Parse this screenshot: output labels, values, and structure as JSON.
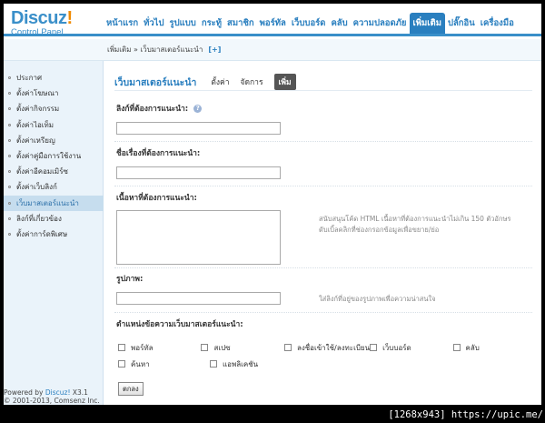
{
  "logo": {
    "main": "Discuz",
    "bang": "!",
    "sub": "Control Panel"
  },
  "nav": {
    "items": [
      {
        "label": "หน้าแรก",
        "active": false
      },
      {
        "label": "ทั่วไป",
        "active": false
      },
      {
        "label": "รูปแบบ",
        "active": false
      },
      {
        "label": "กระทู้",
        "active": false
      },
      {
        "label": "สมาชิก",
        "active": false
      },
      {
        "label": "พอร์ทัล",
        "active": false
      },
      {
        "label": "เว็บบอร์ด",
        "active": false
      },
      {
        "label": "คลับ",
        "active": false
      },
      {
        "label": "ความปลอดภัย",
        "active": false
      },
      {
        "label": "เพิ่มเติม",
        "active": true
      },
      {
        "label": "ปลั๊กอิน",
        "active": false
      },
      {
        "label": "เครื่องมือ",
        "active": false
      }
    ]
  },
  "breadcrumb": {
    "text": "เพิ่มเติม » เว็บมาสเตอร์แนะนำ",
    "add": "[+]"
  },
  "sidebar": {
    "items": [
      {
        "label": "ประกาศ",
        "active": false
      },
      {
        "label": "ตั้งค่าโฆษณา",
        "active": false
      },
      {
        "label": "ตั้งค่ากิจกรรม",
        "active": false
      },
      {
        "label": "ตั้งค่าไอเท็ม",
        "active": false
      },
      {
        "label": "ตั้งค่าเหรียญ",
        "active": false
      },
      {
        "label": "ตั้งค่าคู่มือการใช้งาน",
        "active": false
      },
      {
        "label": "ตั้งค่าอีคอมเมิร์ซ",
        "active": false
      },
      {
        "label": "ตั้งค่าเว็บลิงก์",
        "active": false
      },
      {
        "label": "เว็บมาสเตอร์แนะนำ",
        "active": true
      },
      {
        "label": "ลิงก์ที่เกี่ยวข้อง",
        "active": false
      },
      {
        "label": "ตั้งค่าการ์ดพิเศษ",
        "active": false
      }
    ],
    "powered_prefix": "Powered by ",
    "powered_name": "Discuz!",
    "powered_version": " X3.1",
    "copyright": "© 2001-2013, Comsenz Inc."
  },
  "main": {
    "title": "เว็บมาสเตอร์แนะนำ",
    "tabs": [
      {
        "label": "ตั้งค่า",
        "active": false
      },
      {
        "label": "จัดการ",
        "active": false
      },
      {
        "label": "เพิ่ม",
        "active": true
      }
    ],
    "fields": {
      "link_label": "ลิงก์ที่ต้องการแนะนำ:",
      "help_glyph": "?",
      "link_value": "",
      "subject_label": "ชื่อเรื่องที่ต้องการแนะนำ:",
      "subject_value": "",
      "content_label": "เนื้อหาที่ต้องการแนะนำ:",
      "content_value": "",
      "content_hint_1": "สนับสนุนโค้ด HTML เนื้อหาที่ต้องการแนะนำไม่เกิน 150 ตัวอักษร",
      "content_hint_2": "ดับเบิ้ลคลิกที่ช่องกรอกข้อมูลเพื่อขยาย/ย่อ",
      "image_label": "รูปภาพ:",
      "image_value": "",
      "image_hint": "ใส่ลิงก์ที่อยู่ของรูปภาพเพื่อความน่าสนใจ",
      "position_label": "ตำแหน่งข้อความเว็บมาสเตอร์แนะนำ:"
    },
    "positions": [
      [
        "พอร์ทัล",
        "สเปซ",
        "ลงชื่อเข้าใช้/ลงทะเบียน",
        "เว็บบอร์ด",
        "คลับ"
      ],
      [
        "ค้นหา",
        "แอพลิเคชัน"
      ]
    ],
    "submit": "ตกลง"
  },
  "watermark": "[1268x943] https://upic.me/"
}
